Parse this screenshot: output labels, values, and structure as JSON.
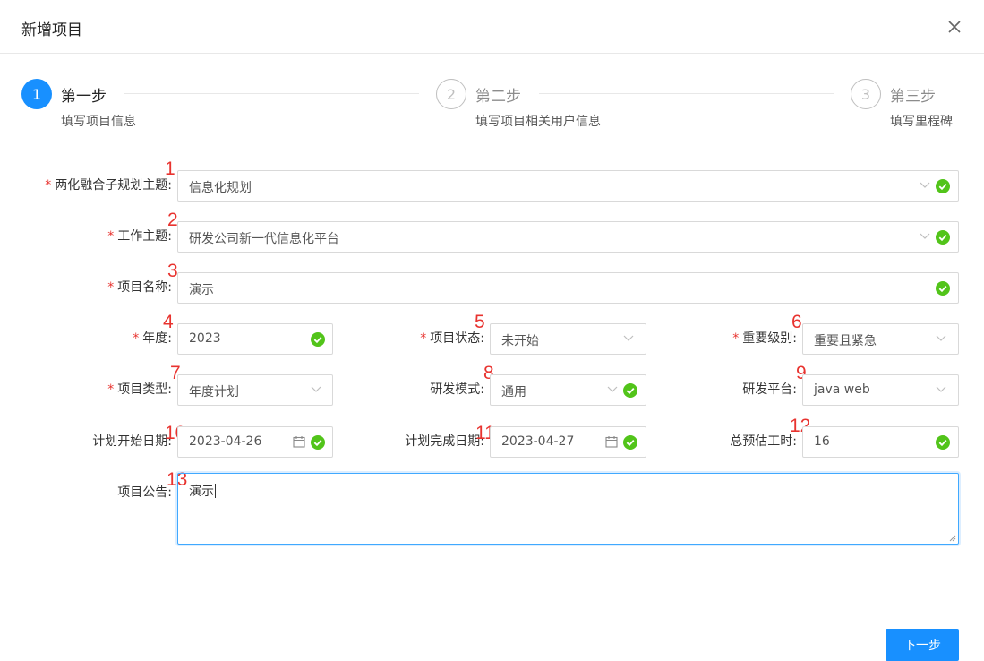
{
  "dialog": {
    "title": "新增项目"
  },
  "steps": [
    {
      "number": "1",
      "title": "第一步",
      "description": "填写项目信息",
      "status": "active"
    },
    {
      "number": "2",
      "title": "第二步",
      "description": "填写项目相关用户信息",
      "status": "wait"
    },
    {
      "number": "3",
      "title": "第三步",
      "description": "填写里程碑",
      "status": "wait"
    }
  ],
  "form": {
    "required_mark": "*",
    "theme": {
      "label": "两化融合子规划主题:",
      "value": "信息化规划",
      "marker": "1"
    },
    "work_theme": {
      "label": "工作主题:",
      "value": "研发公司新一代信息化平台",
      "marker": "2"
    },
    "project_name": {
      "label": "项目名称:",
      "value": "演示",
      "marker": "3"
    },
    "year": {
      "label": "年度:",
      "value": "2023",
      "marker": "4"
    },
    "project_status": {
      "label": "项目状态:",
      "value": "未开始",
      "marker": "5"
    },
    "importance": {
      "label": "重要级别:",
      "value": "重要且紧急",
      "marker": "6"
    },
    "project_type": {
      "label": "项目类型:",
      "value": "年度计划",
      "marker": "7"
    },
    "dev_mode": {
      "label": "研发模式:",
      "value": "通用",
      "marker": "8"
    },
    "dev_platform": {
      "label": "研发平台:",
      "value": "java web",
      "marker": "9"
    },
    "plan_start": {
      "label": "计划开始日期:",
      "value": "2023-04-26",
      "marker": "10"
    },
    "plan_end": {
      "label": "计划完成日期:",
      "value": "2023-04-27",
      "marker": "11"
    },
    "total_hours": {
      "label": "总预估工时:",
      "value": "16",
      "marker": "12"
    },
    "announcement": {
      "label": "项目公告:",
      "value": "演示",
      "marker": "13"
    }
  },
  "footer": {
    "next_label": "下一步"
  },
  "colors": {
    "primary": "#1890ff",
    "success": "#52c41a",
    "required": "#e8332f",
    "marker": "#e8332f"
  },
  "icons": {
    "close": "close-icon",
    "check": "check-circle-icon",
    "dropdown": "chevron-down-icon",
    "calendar": "calendar-icon"
  }
}
